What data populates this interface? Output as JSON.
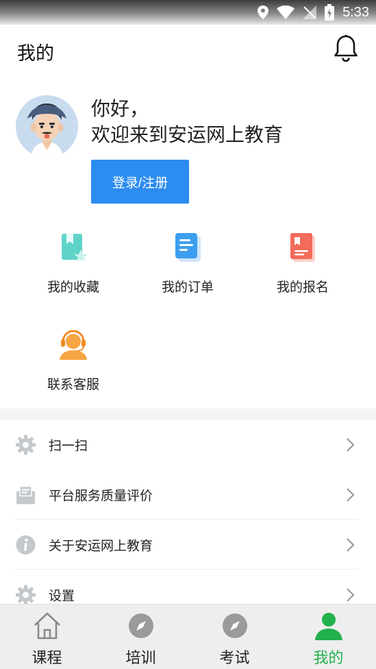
{
  "status_bar": {
    "time": "5:33"
  },
  "header": {
    "title": "我的"
  },
  "profile": {
    "greeting": "你好，",
    "welcome": "欢迎来到安运网上教育",
    "login_button": "登录/注册"
  },
  "quick_actions": [
    {
      "label": "我的收藏",
      "icon": "bookmark-star-icon"
    },
    {
      "label": "我的订单",
      "icon": "order-document-icon"
    },
    {
      "label": "我的报名",
      "icon": "registration-book-icon"
    },
    {
      "label": "联系客服",
      "icon": "customer-service-headset-icon"
    }
  ],
  "menu": [
    {
      "label": "扫一扫",
      "icon": "gear-icon"
    },
    {
      "label": "平台服务质量评价",
      "icon": "message-box-icon"
    },
    {
      "label": "关于安运网上教育",
      "icon": "info-icon"
    },
    {
      "label": "设置",
      "icon": "gear-icon"
    }
  ],
  "tabs": [
    {
      "label": "课程",
      "icon": "home-icon",
      "active": false
    },
    {
      "label": "培训",
      "icon": "compass-icon",
      "active": false
    },
    {
      "label": "考试",
      "icon": "compass-icon",
      "active": false
    },
    {
      "label": "我的",
      "icon": "person-icon",
      "active": true
    }
  ],
  "colors": {
    "primary_button": "#2d8cf0",
    "active_tab": "#22b14c",
    "menu_icon": "#c4c8cc",
    "tab_icon": "#9a9a9a"
  }
}
